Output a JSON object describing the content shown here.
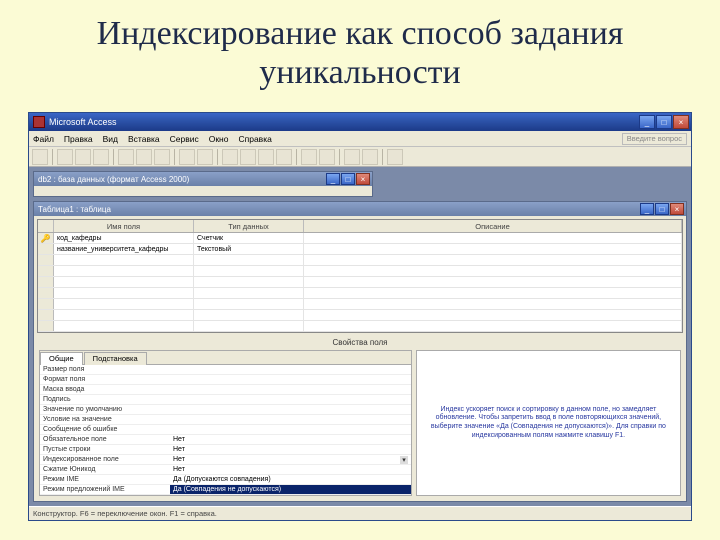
{
  "slide": {
    "title": "Индексирование как способ задания уникальности"
  },
  "app": {
    "title": "Microsoft Access",
    "menus": [
      "Файл",
      "Правка",
      "Вид",
      "Вставка",
      "Сервис",
      "Окно",
      "Справка"
    ],
    "help_hint": "Введите вопрос"
  },
  "db_window": {
    "title": "db2 : база данных (формат Access 2000)"
  },
  "design_window": {
    "title": "Таблица1 : таблица",
    "columns": {
      "name": "Имя поля",
      "type": "Тип данных",
      "desc": "Описание"
    },
    "rows": [
      {
        "key": true,
        "name": "код_кафедры",
        "type": "Счетчик",
        "desc": ""
      },
      {
        "key": false,
        "name": "название_университета_кафедры",
        "type": "Текстовый",
        "desc": ""
      }
    ],
    "props_title": "Свойства поля",
    "tabs": [
      "Общие",
      "Подстановка"
    ],
    "props": [
      {
        "label": "Размер поля",
        "value": ""
      },
      {
        "label": "Формат поля",
        "value": ""
      },
      {
        "label": "Маска ввода",
        "value": ""
      },
      {
        "label": "Подпись",
        "value": ""
      },
      {
        "label": "Значение по умолчанию",
        "value": ""
      },
      {
        "label": "Условие на значение",
        "value": ""
      },
      {
        "label": "Сообщение об ошибке",
        "value": ""
      },
      {
        "label": "Обязательное поле",
        "value": "Нет"
      },
      {
        "label": "Пустые строки",
        "value": "Нет"
      },
      {
        "label": "Индексированное поле",
        "value": "Нет",
        "dropdown": true
      },
      {
        "label": "Сжатие Юникод",
        "value": "Нет"
      },
      {
        "label": "Режим IME",
        "value": "Да (Допускаются совпадения)"
      },
      {
        "label": "Режим предложений IME",
        "value": "Да (Совпадения не допускаются)",
        "selected": true
      }
    ],
    "hint": "Индекс ускоряет поиск и сортировку в данном поле, но замедляет обновление. Чтобы запретить ввод в поле повторяющихся значений, выберите значение «Да (Совпадения не допускаются)». Для справки по индексированным полям нажмите клавишу F1."
  },
  "statusbar": "Конструктор.  F6 = переключение окон.  F1 = справка."
}
